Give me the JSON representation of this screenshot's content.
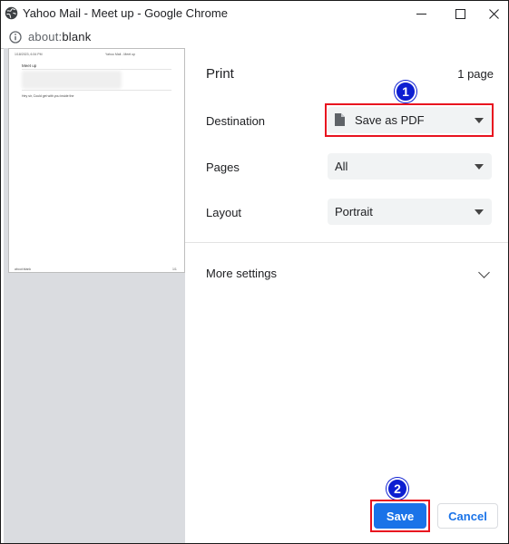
{
  "window": {
    "title": "Yahoo Mail - Meet up - Google Chrome",
    "url_scheme": "about:",
    "url_path": "blank"
  },
  "preview": {
    "header_left": "1/18/2023, 6:34 PM",
    "header_right": "Yahoo Mail - Meet up",
    "subject": "Meet up",
    "body": "Hey sir, Could get with you inside the",
    "footer_left": "about:blank",
    "footer_right": "1/1"
  },
  "print": {
    "title": "Print",
    "page_count": "1 page",
    "destination_label": "Destination",
    "destination_value": "Save as PDF",
    "pages_label": "Pages",
    "pages_value": "All",
    "layout_label": "Layout",
    "layout_value": "Portrait",
    "more_settings": "More settings",
    "save_label": "Save",
    "cancel_label": "Cancel"
  },
  "annotations": {
    "step1": "1",
    "step2": "2",
    "highlight_color": "#e8131f",
    "badge_color": "#0d1fd1"
  },
  "colors": {
    "primary": "#1a73e8",
    "select_bg": "#f1f3f4",
    "preview_bg": "#dadce0"
  }
}
